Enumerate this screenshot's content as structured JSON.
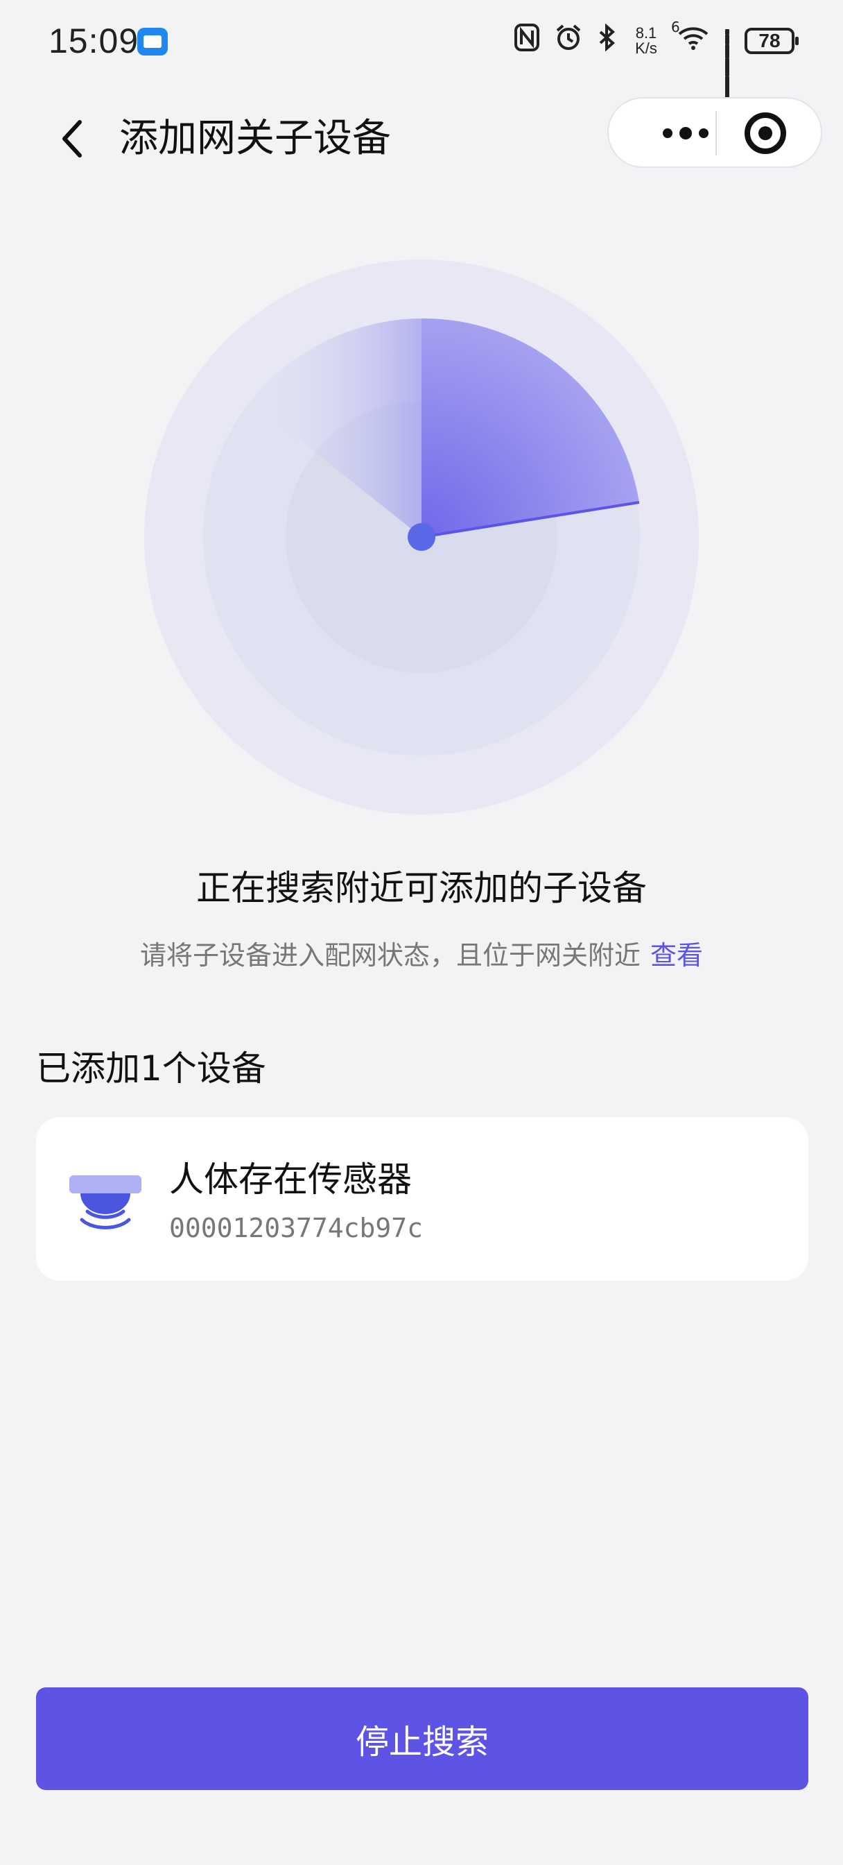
{
  "status_bar": {
    "time": "15:09",
    "speed_value": "8.1",
    "speed_unit": "K/s",
    "network_badge": "6",
    "battery": "78",
    "icons": [
      "mail-icon",
      "nfc-icon",
      "alarm-icon",
      "bluetooth-icon",
      "wifi-icon",
      "signal-icon",
      "battery-icon"
    ]
  },
  "nav": {
    "title": "添加网关子设备",
    "back_icon": "chevron-left-icon",
    "more_icon": "more-dots-icon",
    "close_icon": "target-close-icon"
  },
  "search": {
    "title": "正在搜索附近可添加的子设备",
    "hint": "请将子设备进入配网状态，且位于网关附近",
    "link": "查看"
  },
  "added": {
    "title": "已添加1个设备",
    "devices": [
      {
        "name": "人体存在传感器",
        "id": "00001203774cb97c",
        "icon": "presence-sensor-icon"
      }
    ]
  },
  "actions": {
    "stop_label": "停止搜索"
  },
  "colors": {
    "accent": "#5d54e6",
    "background": "#f3f3f6",
    "link": "#5b54e6"
  }
}
